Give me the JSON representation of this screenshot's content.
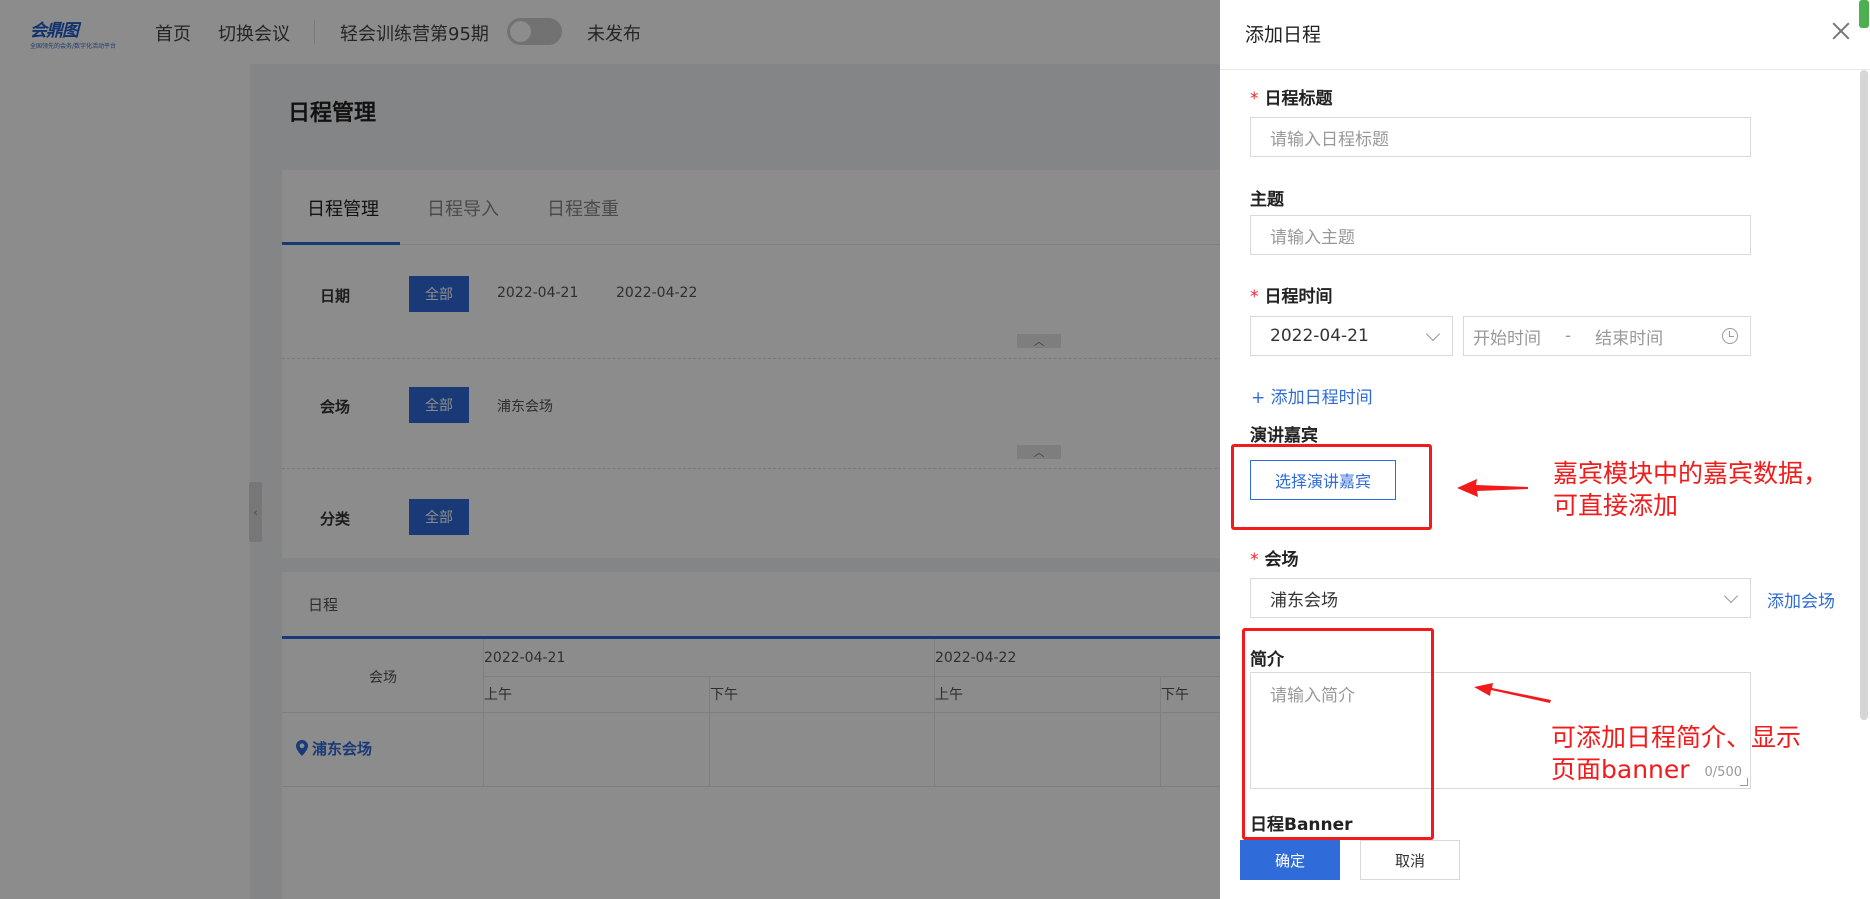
{
  "header": {
    "logo_mark": "会鼎图",
    "logo_slogan": "全国领先的会务/数字化活动平台",
    "nav": [
      "首页",
      "切换会议"
    ],
    "meeting_name": "轻会训练营第95期",
    "publish_toggle": false,
    "publish_status": "未发布"
  },
  "page": {
    "title": "日程管理"
  },
  "tabs": [
    "日程管理",
    "日程导入",
    "日程查重"
  ],
  "filters": {
    "date_label": "日期",
    "date_all": "全部",
    "dates": [
      "2022-04-21",
      "2022-04-22"
    ],
    "venue_label": "会场",
    "venue_all": "全部",
    "venues": [
      "浦东会场"
    ],
    "category_label": "分类",
    "category_all": "全部",
    "collapse_icon": "chevron-up-icon"
  },
  "schedule": {
    "header": "日程",
    "venue_col": "会场",
    "days": [
      {
        "date": "2022-04-21",
        "am": "上午",
        "pm": "下午"
      },
      {
        "date": "2022-04-22",
        "am": "上午",
        "pm": "下午"
      }
    ],
    "rows": [
      {
        "venue": "浦东会场"
      }
    ]
  },
  "drawer": {
    "title": "添加日程",
    "fields": {
      "title_label": "日程标题",
      "title_placeholder": "请输入日程标题",
      "theme_label": "主题",
      "theme_placeholder": "请输入主题",
      "time_label": "日程时间",
      "time_date": "2022-04-21",
      "time_start_placeholder": "开始时间",
      "time_sep": "-",
      "time_end_placeholder": "结束时间",
      "add_time_link": "+ 添加日程时间",
      "speaker_label": "演讲嘉宾",
      "speaker_button": "选择演讲嘉宾",
      "venue_label": "会场",
      "venue_value": "浦东会场",
      "add_venue_link": "添加会场",
      "intro_label": "简介",
      "intro_placeholder": "请输入简介",
      "intro_counter": "0/500",
      "banner_label": "日程Banner"
    },
    "confirm_button": "确定",
    "cancel_button": "取消"
  },
  "annotations": {
    "speaker_note_line1": "嘉宾模块中的嘉宾数据，",
    "speaker_note_line2": "可直接添加",
    "intro_note_line1": "可添加日程简介、显示",
    "intro_note_line2": "页面banner",
    "accent_color": "#f21b1b"
  }
}
